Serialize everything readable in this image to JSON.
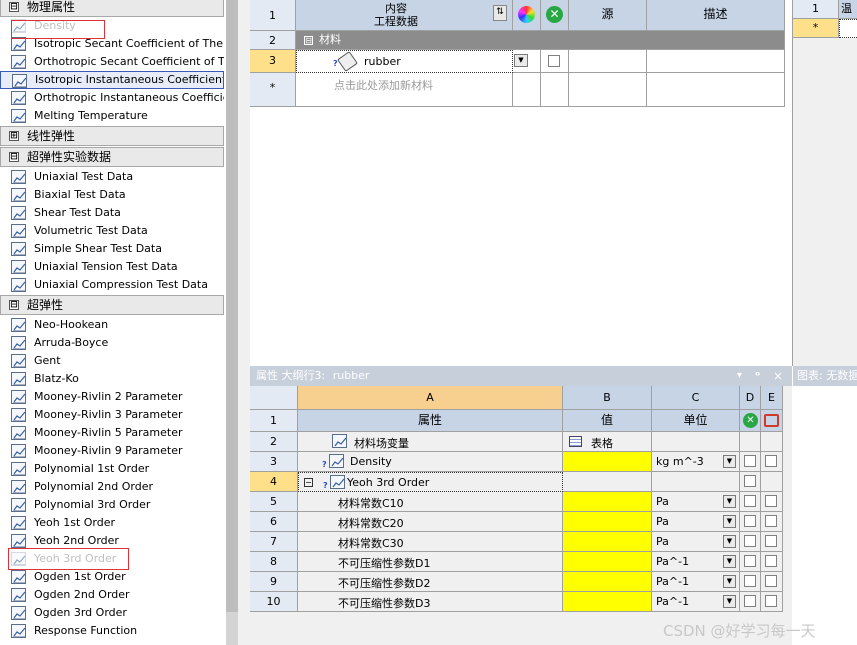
{
  "toolbox": {
    "sections": [
      {
        "label": "物理属性",
        "toggle": "⊟"
      },
      {
        "label": "线性弹性",
        "toggle": "⊞"
      },
      {
        "label": "超弹性实验数据",
        "toggle": "⊟"
      },
      {
        "label": "超弹性",
        "toggle": "⊟"
      }
    ],
    "physical_items": [
      "Density",
      "Isotropic Secant Coefficient of Therma",
      "Orthotropic Secant Coefficient of Ther",
      "Isotropic Instantaneous Coefficient of",
      "Orthotropic Instantaneous Coefficien",
      "Melting Temperature"
    ],
    "experimental_items": [
      "Uniaxial Test Data",
      "Biaxial Test Data",
      "Shear Test Data",
      "Volumetric Test Data",
      "Simple Shear Test Data",
      "Uniaxial Tension Test Data",
      "Uniaxial Compression Test Data"
    ],
    "hyperelastic_items": [
      "Neo-Hookean",
      "Arruda-Boyce",
      "Gent",
      "Blatz-Ko",
      "Mooney-Rivlin 2 Parameter",
      "Mooney-Rivlin 3 Parameter",
      "Mooney-Rivlin 5 Parameter",
      "Mooney-Rivlin 9 Parameter",
      "Polynomial 1st Order",
      "Polynomial 2nd Order",
      "Polynomial 3rd Order",
      "Yeoh 1st Order",
      "Yeoh 2nd Order",
      "Yeoh 3rd Order",
      "Ogden 1st Order",
      "Ogden 2nd Order",
      "Ogden 3rd Order",
      "Response Function"
    ]
  },
  "outline": {
    "row_numbers": [
      "1",
      "2",
      "3",
      "*"
    ],
    "header_content": "内容\n工程数据",
    "header_source": "源",
    "header_desc": "描述",
    "group_label": "材料",
    "group_toggle": "⊟",
    "material_name": "rubber",
    "add_new_placeholder": "点击此处添加新材料",
    "sort_icon": "sort-icon",
    "color_icon": "color-wheel-icon",
    "suppress_icon": "green-x-icon"
  },
  "right_top": {
    "row_numbers": [
      "1",
      "*"
    ],
    "header_partial": "温"
  },
  "properties": {
    "title_prefix": "属性 大纲行3:",
    "title_material": "rubber",
    "pin_label": "▾",
    "pin_icon": "pin-icon",
    "close_label": "×",
    "col_letters": [
      "A",
      "B",
      "C",
      "D",
      "E"
    ],
    "headers": {
      "property": "属性",
      "value": "值",
      "unit": "单位"
    },
    "rows": [
      {
        "num": "2",
        "name": "材料场变量",
        "value": "表格",
        "unit": "",
        "kind": "table"
      },
      {
        "num": "3",
        "name": "Density",
        "value": "",
        "unit": "kg m^-3",
        "kind": "prop"
      },
      {
        "num": "4",
        "name": "Yeoh 3rd Order",
        "value": "",
        "unit": "",
        "kind": "group"
      },
      {
        "num": "5",
        "name": "材料常数C10",
        "value": "",
        "unit": "Pa",
        "kind": "sub"
      },
      {
        "num": "6",
        "name": "材料常数C20",
        "value": "",
        "unit": "Pa",
        "kind": "sub"
      },
      {
        "num": "7",
        "name": "材料常数C30",
        "value": "",
        "unit": "Pa",
        "kind": "sub"
      },
      {
        "num": "8",
        "name": "不可压缩性参数D1",
        "value": "",
        "unit": "Pa^-1",
        "kind": "sub"
      },
      {
        "num": "9",
        "name": "不可压缩性参数D2",
        "value": "",
        "unit": "Pa^-1",
        "kind": "sub"
      },
      {
        "num": "10",
        "name": "不可压缩性参数D3",
        "value": "",
        "unit": "Pa^-1",
        "kind": "sub"
      }
    ]
  },
  "chart_title": "图表: 无数据",
  "watermark": "CSDN @好学习每一天",
  "colors": {
    "yellow": "#ffff00",
    "header": "#c7d4e6",
    "section": "#e9e9e9",
    "highlight": "#3a5ab8"
  }
}
